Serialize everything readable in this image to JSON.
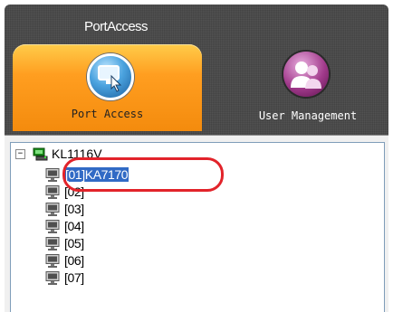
{
  "window": {
    "title": "PortAccess"
  },
  "tabs": [
    {
      "label": "Port Access",
      "icon": "port-access-icon",
      "active": true
    },
    {
      "label": "User Management",
      "icon": "user-management-icon",
      "active": false
    }
  ],
  "tree": {
    "root": {
      "label": "KL1116V",
      "icon": "kvm-switch-icon",
      "expanded": true,
      "expander": "−"
    },
    "ports": [
      {
        "label": "[01]KA7170",
        "selected": true
      },
      {
        "label": "[02]"
      },
      {
        "label": "[03]"
      },
      {
        "label": "[04]"
      },
      {
        "label": "[05]"
      },
      {
        "label": "[06]"
      },
      {
        "label": "[07]"
      }
    ]
  },
  "colors": {
    "active_tab": "#f48b0d",
    "selection": "#316ac5",
    "highlight": "#e2232a",
    "frame": "#4b4b4b"
  }
}
